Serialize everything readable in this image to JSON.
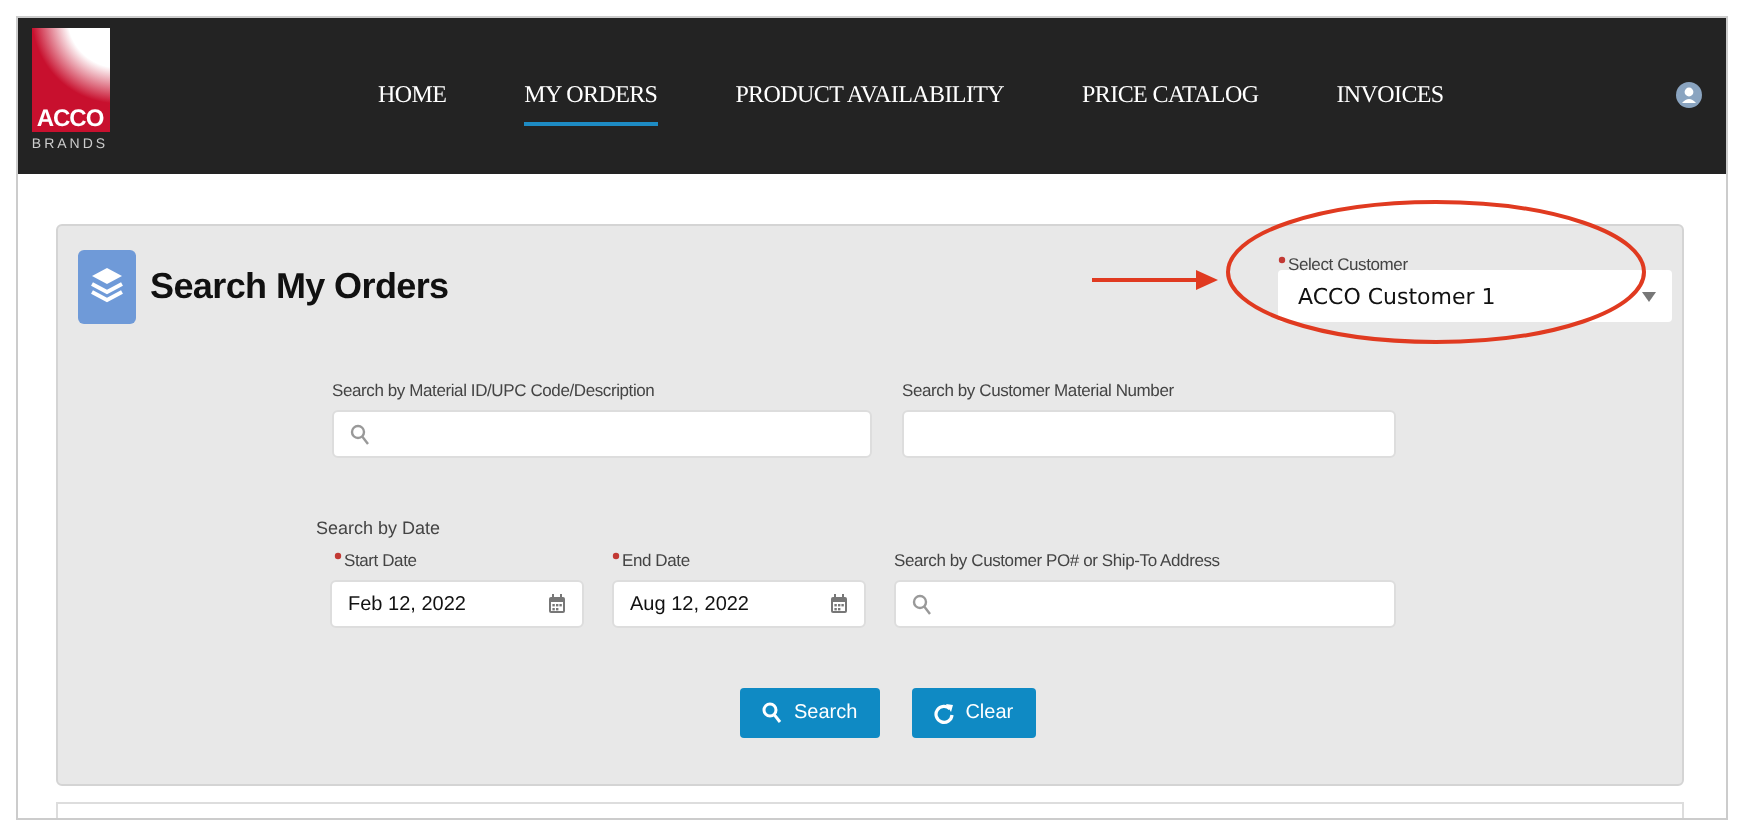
{
  "brand": {
    "name": "ACCO",
    "sub": "BRANDS"
  },
  "nav": [
    {
      "label": "HOME",
      "selected": false
    },
    {
      "label": "MY ORDERS",
      "selected": true
    },
    {
      "label": "PRODUCT AVAILABILITY",
      "selected": false
    },
    {
      "label": "PRICE CATALOG",
      "selected": false
    },
    {
      "label": "INVOICES",
      "selected": false
    }
  ],
  "panel": {
    "title": "Search My Orders",
    "customer": {
      "label": "Select Customer",
      "required": true,
      "value": "ACCO Customer 1"
    },
    "row1": [
      {
        "label": "Search by Material ID/UPC Code/Description",
        "kind": "search"
      },
      {
        "label": "Search by Customer Material Number",
        "kind": "text"
      }
    ],
    "date_heading": "Search by Date",
    "row2": [
      {
        "label": "Start Date",
        "required": true,
        "kind": "date",
        "value": "Feb 12, 2022"
      },
      {
        "label": "End Date",
        "required": true,
        "kind": "date",
        "value": "Aug 12, 2022"
      },
      {
        "label": "Search by Customer PO# or Ship-To Address",
        "required": false,
        "kind": "search"
      }
    ],
    "buttons": [
      {
        "label": "Search",
        "kind": "search"
      },
      {
        "label": "Clear",
        "kind": "clear"
      }
    ]
  }
}
